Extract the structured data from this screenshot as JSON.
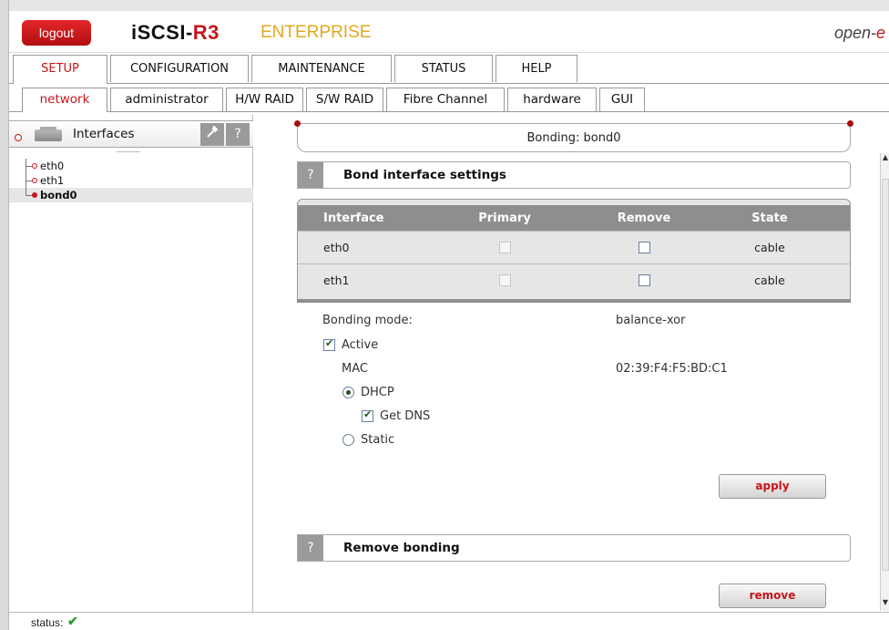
{
  "header": {
    "logout_label": "logout",
    "brand_main": "iSCSI-",
    "brand_r3": "R3",
    "edition": "ENTERPRISE",
    "vendor_prefix": "open-",
    "vendor_suffix": "e"
  },
  "main_tabs": [
    {
      "label": "SETUP",
      "active": true
    },
    {
      "label": "CONFIGURATION",
      "active": false
    },
    {
      "label": "MAINTENANCE",
      "active": false
    },
    {
      "label": "STATUS",
      "active": false
    },
    {
      "label": "HELP",
      "active": false
    }
  ],
  "sub_tabs": [
    {
      "label": "network",
      "active": true
    },
    {
      "label": "administrator",
      "active": false
    },
    {
      "label": "H/W RAID",
      "active": false
    },
    {
      "label": "S/W RAID",
      "active": false
    },
    {
      "label": "Fibre Channel",
      "active": false
    },
    {
      "label": "hardware",
      "active": false
    },
    {
      "label": "GUI",
      "active": false
    }
  ],
  "left_panel": {
    "title": "Interfaces",
    "tool_icon": "wrench-icon",
    "help_label": "?",
    "tree": [
      {
        "label": "eth0",
        "selected": false
      },
      {
        "label": "eth1",
        "selected": false
      },
      {
        "label": "bond0",
        "selected": true
      }
    ]
  },
  "content": {
    "page_title": "Bonding: bond0",
    "bond_section": {
      "help_label": "?",
      "title": "Bond interface settings",
      "columns": [
        "Interface",
        "Primary",
        "Remove",
        "State"
      ],
      "rows": [
        {
          "interface": "eth0",
          "primary_checked": false,
          "primary_enabled": false,
          "remove_checked": false,
          "state": "cable"
        },
        {
          "interface": "eth1",
          "primary_checked": false,
          "primary_enabled": false,
          "remove_checked": false,
          "state": "cable"
        }
      ],
      "bonding_mode_label": "Bonding mode:",
      "bonding_mode_value": "balance-xor",
      "active_label": "Active",
      "active_checked": true,
      "mac_label": "MAC",
      "mac_value": "02:39:F4:F5:BD:C1",
      "dhcp_label": "DHCP",
      "dhcp_selected": true,
      "get_dns_label": "Get DNS",
      "get_dns_checked": true,
      "static_label": "Static",
      "static_selected": false,
      "apply_label": "apply"
    },
    "remove_section": {
      "help_label": "?",
      "title": "Remove bonding",
      "remove_label": "remove"
    }
  },
  "status_bar": {
    "label": "status:",
    "icon": "check-icon",
    "icon_glyph": "✔",
    "icon_color": "#2e9a2e"
  },
  "colors": {
    "accent_red": "#c4161b",
    "edition_gold": "#e3a81f",
    "table_header_gray": "#8e8e8e"
  }
}
